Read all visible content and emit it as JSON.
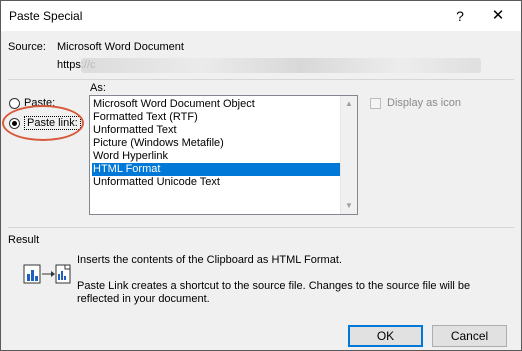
{
  "window": {
    "title": "Paste Special",
    "help_glyph": "?",
    "close_glyph": "✕"
  },
  "source": {
    "label": "Source:",
    "value": "Microsoft Word Document",
    "url_visible": "https://c"
  },
  "paste_options": {
    "as_label": "As:",
    "paste_label": "Paste:",
    "paste_link_label": "Paste link:",
    "selected": "Paste link:"
  },
  "formats": {
    "items": [
      "Microsoft Word Document Object",
      "Formatted Text (RTF)",
      "Unformatted Text",
      "Picture (Windows Metafile)",
      "Word Hyperlink",
      "HTML Format",
      "Unformatted Unicode Text"
    ],
    "selected_index": 5,
    "selected_color": "#0078d7"
  },
  "display_as_icon": {
    "label": "Display as icon",
    "checked": false,
    "enabled": false
  },
  "result": {
    "label": "Result",
    "line1": "Inserts the contents of the Clipboard as HTML Format.",
    "line2": "Paste Link creates a shortcut to the source file. Changes to the source file will be reflected in your document.",
    "icon": "paste-link-result-icon"
  },
  "buttons": {
    "ok": "OK",
    "cancel": "Cancel"
  },
  "accent": {
    "highlight_ellipse_color": "#d85a3a"
  }
}
